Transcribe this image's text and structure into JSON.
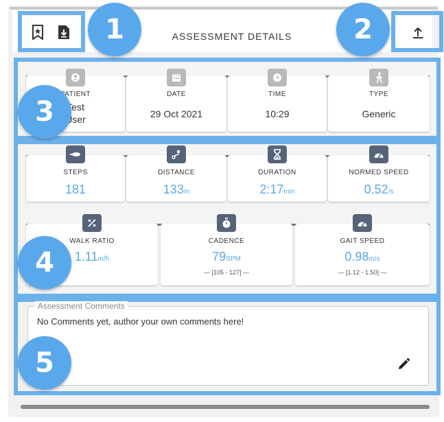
{
  "header": {
    "title": "ASSESSMENT DETAILS",
    "bookmark_icon": "bookmark-star-icon",
    "download_icon": "file-download-icon",
    "upload_icon": "upload-icon"
  },
  "callouts": [
    "1",
    "2",
    "3",
    "4",
    "5"
  ],
  "info": {
    "items": [
      {
        "label": "PATIENT",
        "value_line1": "Test",
        "value_line2": "User",
        "icon": "person-icon"
      },
      {
        "label": "DATE",
        "value": "29 Oct 2021",
        "icon": "calendar-icon"
      },
      {
        "label": "TIME",
        "value": "10:29",
        "icon": "clock-icon"
      },
      {
        "label": "TYPE",
        "value": "Generic",
        "icon": "walking-icon"
      }
    ]
  },
  "metrics_top": [
    {
      "label": "STEPS",
      "value": "181",
      "unit": "",
      "icon": "footprint-icon"
    },
    {
      "label": "DISTANCE",
      "value": "133",
      "unit": "m",
      "icon": "route-icon"
    },
    {
      "label": "DURATION",
      "value": "2:17",
      "unit": "min",
      "icon": "hourglass-icon"
    },
    {
      "label": "NORMED SPEED",
      "value": "0.52",
      "unit": "/s",
      "icon": "speedometer-icon"
    }
  ],
  "metrics_bottom": [
    {
      "label": "WALK RATIO",
      "value": "1.11",
      "unit": "m/h",
      "range": "",
      "icon": "percent-icon"
    },
    {
      "label": "CADENCE",
      "value": "79",
      "unit": "SPM",
      "range": "105 - 127",
      "icon": "stopwatch-icon"
    },
    {
      "label": "GAIT SPEED",
      "value": "0.98",
      "unit": "m/s",
      "range": "1.12 - 1.50",
      "icon": "speedometer-icon"
    }
  ],
  "comments": {
    "legend": "Assessment Comments",
    "text": "No Comments yet, author your own comments here!",
    "edit_icon": "pencil-icon"
  },
  "colors": {
    "accent": "#5aa8ec",
    "highlight": "#6cb0ec",
    "icon_dark": "#56647a",
    "icon_gray": "#b9b9b9"
  }
}
